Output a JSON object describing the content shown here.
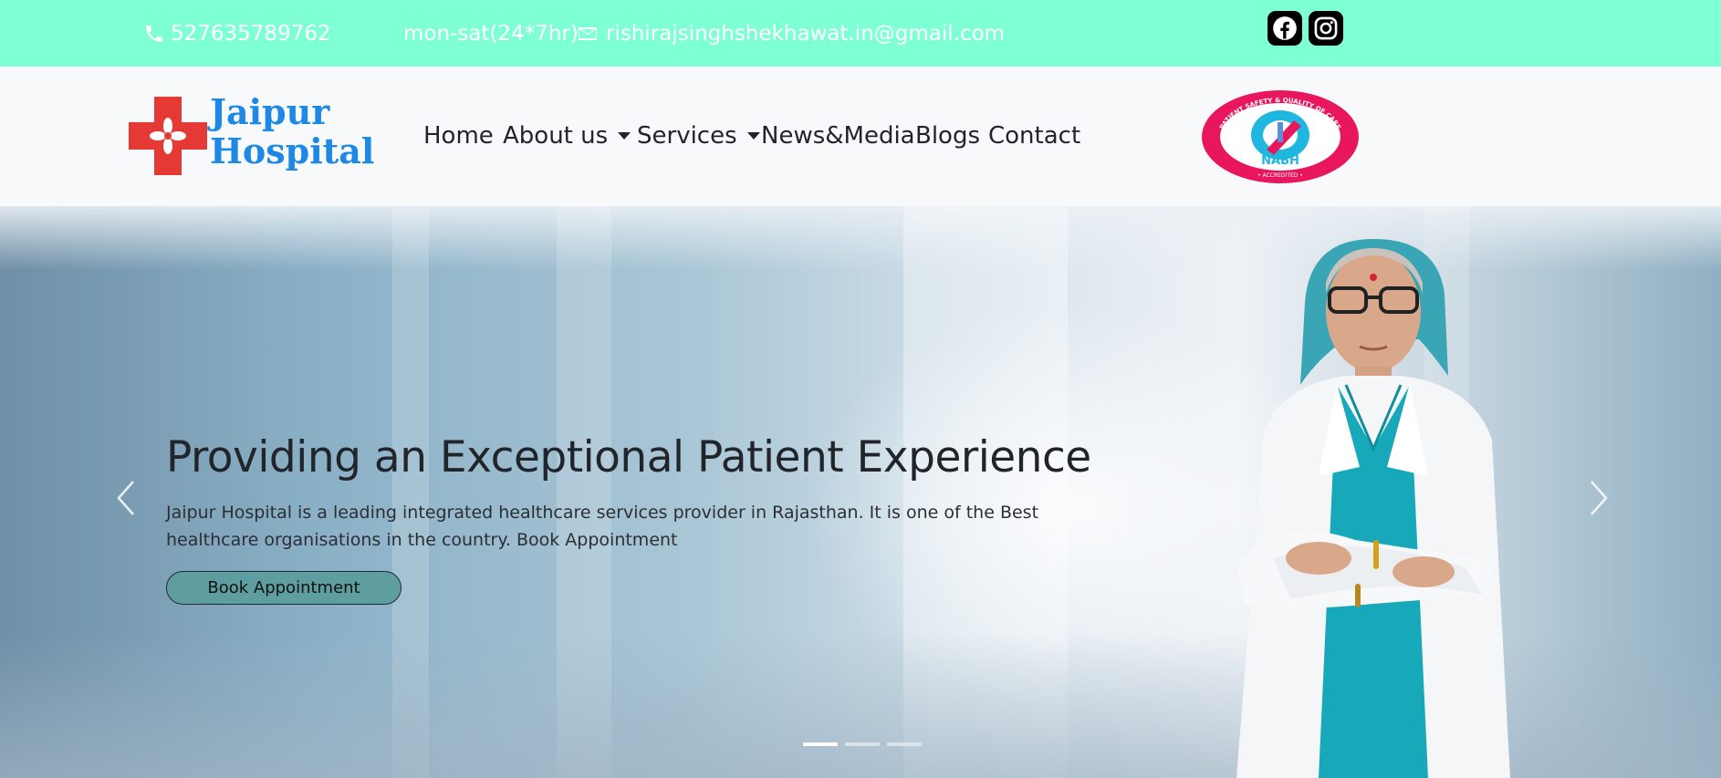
{
  "topbar": {
    "phone": "527635789762",
    "hours": "mon-sat(24*7hr)",
    "email": "rishirajsinghshekhawat.in@gmail.com",
    "icons": {
      "phone": "phone-icon",
      "email": "envelope-icon",
      "facebook": "facebook-icon",
      "instagram": "instagram-icon"
    }
  },
  "brand": {
    "line1": "Jaipur",
    "line2": "Hospital"
  },
  "nav": {
    "items": [
      {
        "label": "Home",
        "dropdown": false
      },
      {
        "label": "About us",
        "dropdown": true
      },
      {
        "label": "Services",
        "dropdown": true
      },
      {
        "label": "News&Media",
        "dropdown": false
      },
      {
        "label": "Blogs",
        "dropdown": false
      },
      {
        "label": "Contact",
        "dropdown": false
      }
    ]
  },
  "badge": {
    "arc_text": "PATIENT SAFETY & QUALITY OF CARE",
    "name": "NABH",
    "bottom_text": "• ACCREDITED •"
  },
  "hero": {
    "title": "Providing an Exceptional Patient Experience",
    "description": "Jaipur Hospital is a leading integrated healthcare services provider in Rajasthan. It is one of the Best healthcare organisations in the country. Book Appointment",
    "button_label": "Book Appointment",
    "slide_count": 3,
    "active_slide": 1
  },
  "colors": {
    "topbar_bg": "#7fffd4",
    "navbar_bg": "#f8f9fb",
    "brand_blue": "#1e88e5",
    "logo_red": "#e53935",
    "button_bg": "#5f9ea0",
    "badge_pink": "#e8175d"
  }
}
